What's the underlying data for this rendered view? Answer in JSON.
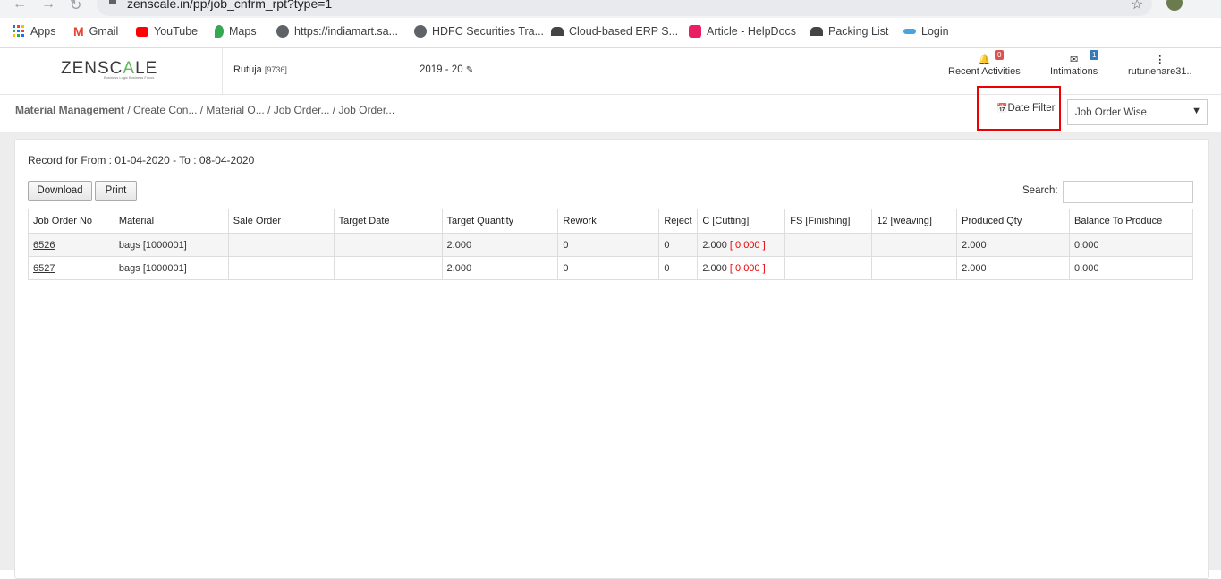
{
  "browser": {
    "url": "zenscale.in/pp/job_cnfrm_rpt?type=1",
    "bookmarks": [
      {
        "label": "Apps",
        "icon": "apps-grid-icon"
      },
      {
        "label": "Gmail",
        "icon": "gmail-icon"
      },
      {
        "label": "YouTube",
        "icon": "youtube-icon"
      },
      {
        "label": "Maps",
        "icon": "maps-icon"
      },
      {
        "label": "https://indiamart.sa...",
        "icon": "globe-icon"
      },
      {
        "label": "HDFC Securities Tra...",
        "icon": "globe-icon"
      },
      {
        "label": "Cloud-based ERP S...",
        "icon": "person-icon"
      },
      {
        "label": "Article - HelpDocs",
        "icon": "helpdocs-icon"
      },
      {
        "label": "Packing List",
        "icon": "person-icon"
      },
      {
        "label": "Login",
        "icon": "login-icon"
      }
    ]
  },
  "header": {
    "logo_left": "ZENSC",
    "logo_accent": "A",
    "logo_right": "LE",
    "logo_tagline": "Business Logic Business Focus",
    "user_name": "Rutuja",
    "user_id": "[9736]",
    "fiscal_year": "2019 - 20",
    "recent_activities_label": "Recent Activities",
    "recent_activities_count": "0",
    "intimations_label": "Intimations",
    "intimations_count": "1",
    "account_label": "rutunehare31.."
  },
  "breadcrumb": {
    "root": "Material Management",
    "rest": " / Create Con... / Material O... / Job Order... / Job Order..."
  },
  "filter": {
    "date_filter_label": "Date Filter",
    "grouping_value": "Job Order Wise"
  },
  "report": {
    "record_text": "Record for From : 01-04-2020 - To : 08-04-2020",
    "download_label": "Download",
    "print_label": "Print",
    "search_label": "Search:",
    "columns": [
      "Job Order No",
      "Material",
      "Sale Order",
      "Target Date",
      "Target Quantity",
      "Rework",
      "Reject",
      "C [Cutting]",
      "FS [Finishing]",
      "12 [weaving]",
      "Produced Qty",
      "Balance To Produce"
    ],
    "rows": [
      {
        "job_order_no": "6526",
        "material": "bags [1000001]",
        "sale_order": "",
        "target_date": "",
        "target_quantity": "2.000",
        "rework": "0",
        "reject": "0",
        "cutting": "2.000",
        "cutting_pending": "[ 0.000 ]",
        "finishing": "",
        "weaving": "",
        "produced_qty": "2.000",
        "balance": "0.000"
      },
      {
        "job_order_no": "6527",
        "material": "bags [1000001]",
        "sale_order": "",
        "target_date": "",
        "target_quantity": "2.000",
        "rework": "0",
        "reject": "0",
        "cutting": "2.000",
        "cutting_pending": "[ 0.000 ]",
        "finishing": "",
        "weaving": "",
        "produced_qty": "2.000",
        "balance": "0.000"
      }
    ]
  },
  "colors": {
    "highlight_border": "#ee0000",
    "logo_accent": "#5cb85c",
    "badge_red": "#d9534f",
    "badge_blue": "#337ab7"
  }
}
